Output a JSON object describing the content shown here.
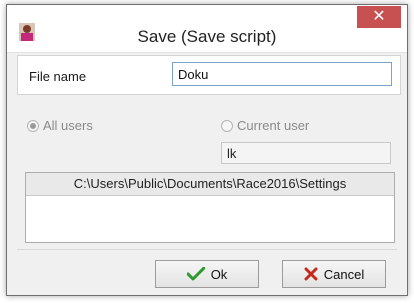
{
  "window": {
    "title": "Save (Save script)",
    "close_glyph": "✕"
  },
  "file": {
    "label": "File name",
    "value": "Doku"
  },
  "scope": {
    "all_users_label": "All users",
    "current_user_label": "Current user",
    "selected": "All users",
    "user_value": "lk"
  },
  "path": {
    "folder": "C:\\Users\\Public\\Documents\\Race2016\\Settings"
  },
  "buttons": {
    "ok_label": "Ok",
    "cancel_label": "Cancel"
  },
  "icons": {
    "app": "person-icon",
    "ok": "checkmark-icon",
    "cancel": "x-mark-icon"
  },
  "colors": {
    "close_button": "#c75050",
    "ok_icon": "#2e9a2e",
    "cancel_icon": "#c42a1c"
  }
}
